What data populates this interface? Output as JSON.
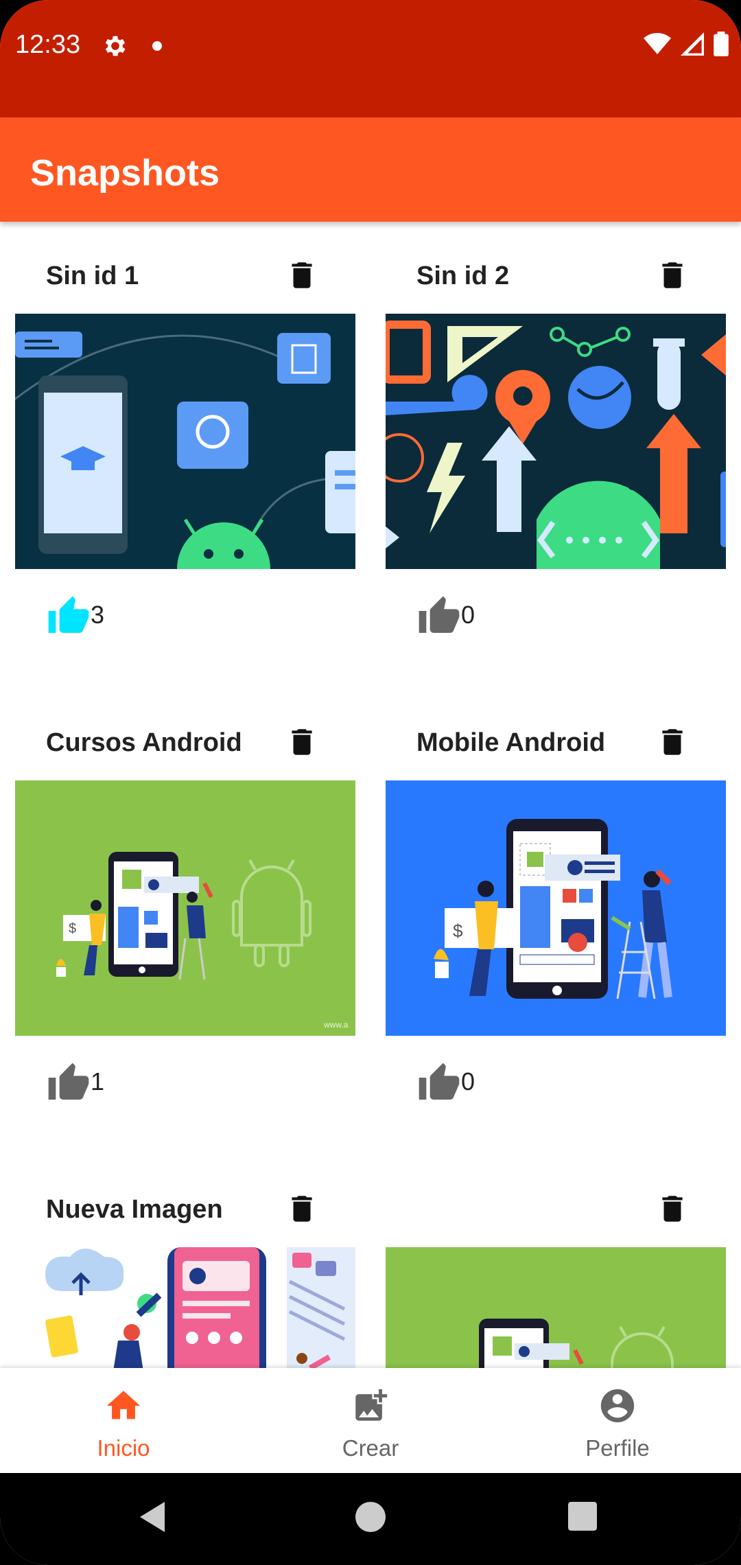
{
  "status_bar": {
    "time": "12:33",
    "color": "#C41E00"
  },
  "app_bar": {
    "title": "Snapshots",
    "color": "#FF5722"
  },
  "snapshots": [
    {
      "title": "Sin id 1",
      "likes": "3",
      "liked": true,
      "image": "android-education-illustration"
    },
    {
      "title": "Sin id 2",
      "likes": "0",
      "liked": false,
      "image": "android-developer-icons-illustration"
    },
    {
      "title": "Cursos Android",
      "likes": "1",
      "liked": false,
      "image": "android-courses-green-illustration"
    },
    {
      "title": "Mobile Android",
      "likes": "0",
      "liked": false,
      "image": "mobile-android-blue-illustration"
    },
    {
      "title": "Nueva Imagen",
      "likes": "",
      "liked": false,
      "image": "app-design-illustration"
    },
    {
      "title": "",
      "likes": "",
      "liked": false,
      "image": "android-courses-green-illustration"
    }
  ],
  "bottom_nav": {
    "items": [
      {
        "label": "Inicio",
        "icon": "home-icon",
        "active": true
      },
      {
        "label": "Crear",
        "icon": "add-photo-icon",
        "active": false
      },
      {
        "label": "Perfile",
        "icon": "account-circle-icon",
        "active": false
      }
    ]
  },
  "colors": {
    "accent": "#FF5722",
    "liked": "#00E5FF",
    "unliked": "#666666"
  }
}
